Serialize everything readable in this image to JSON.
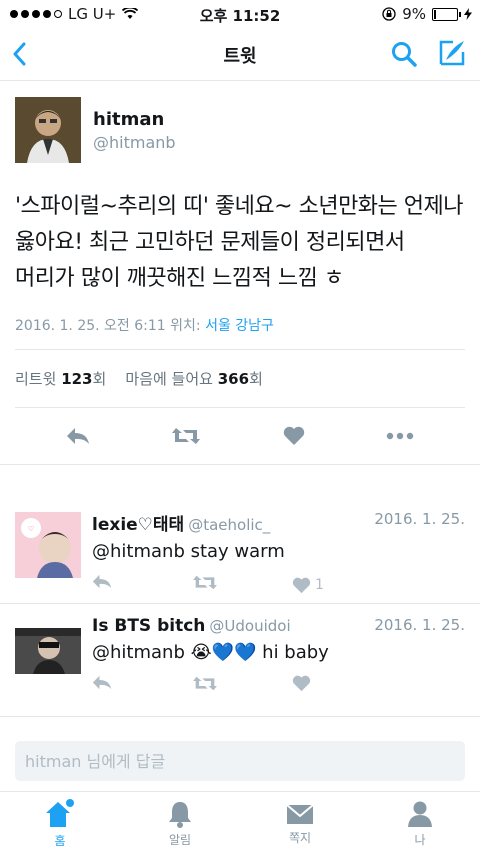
{
  "status": {
    "carrier": "LG U+",
    "time": "오후 11:52",
    "battery": "9%"
  },
  "nav": {
    "title": "트윗",
    "back_icon": "back-chevron-icon",
    "search_icon": "search-icon",
    "compose_icon": "compose-icon"
  },
  "tweet": {
    "name": "hitman",
    "handle": "@hitmanb",
    "text": "'스파이럴~추리의 띠' 좋네요~ 소년만화는 언제나 옳아요! 최근 고민하던 문제들이 정리되면서 머리가 많이 깨끗해진 느낌적 느낌 ㅎ",
    "datetime": "2016. 1. 25. 오전 6:11 위치: ",
    "location": "서울 강남구",
    "retweet_label": "리트윗",
    "retweet_count": "123",
    "retweet_unit": "회",
    "like_label": "마음에 들어요",
    "like_count": "366",
    "like_unit": "회"
  },
  "replies": [
    {
      "name": "lexie♡태태",
      "handle": "@taeholic_",
      "date": "2016. 1. 25.",
      "text": "@hitmanb stay warm",
      "like_count": "1"
    },
    {
      "name": "Is BTS bitch",
      "handle": "@Udouidoi",
      "date": "2016. 1. 25.",
      "text": "@hitmanb 😭💙💙 hi baby",
      "like_count": ""
    }
  ],
  "reply_box": {
    "placeholder": "hitman 님에게 답글"
  },
  "tabs": [
    {
      "label": "홈",
      "icon": "home-icon"
    },
    {
      "label": "알림",
      "icon": "bell-icon"
    },
    {
      "label": "쪽지",
      "icon": "envelope-icon"
    },
    {
      "label": "나",
      "icon": "person-icon"
    }
  ],
  "colors": {
    "accent": "#1da1f2",
    "muted": "#8899a6"
  }
}
